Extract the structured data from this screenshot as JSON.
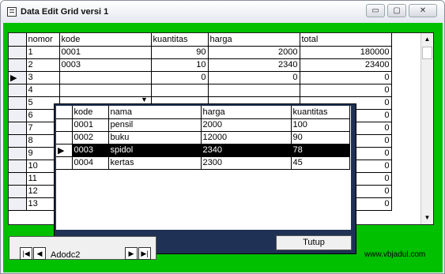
{
  "window": {
    "title": "Data Edit Grid versi 1",
    "controls": {
      "minimize": "▭",
      "maximize": "▢",
      "close": "✕"
    }
  },
  "grid": {
    "columns": [
      "nomor",
      "kode",
      "kuantitas",
      "harga",
      "total"
    ],
    "rows": [
      {
        "nomor": "1",
        "kode": "0001",
        "kuantitas": "90",
        "harga": "2000",
        "total": "180000"
      },
      {
        "nomor": "2",
        "kode": "0003",
        "kuantitas": "10",
        "harga": "2340",
        "total": "23400"
      },
      {
        "nomor": "3",
        "kode": "",
        "kuantitas": "0",
        "harga": "0",
        "total": "0"
      },
      {
        "nomor": "4",
        "total": "0"
      },
      {
        "nomor": "5",
        "total": "0"
      },
      {
        "nomor": "6",
        "total": "0"
      },
      {
        "nomor": "7",
        "total": "0"
      },
      {
        "nomor": "8",
        "total": "0"
      },
      {
        "nomor": "9",
        "total": "0"
      },
      {
        "nomor": "10",
        "total": "0"
      },
      {
        "nomor": "11",
        "total": "0"
      },
      {
        "nomor": "12",
        "total": "0"
      },
      {
        "nomor": "13",
        "total": "0"
      }
    ],
    "current_row_marker": "▶"
  },
  "dropdown": {
    "columns": [
      "kode",
      "nama",
      "harga",
      "kuantitas"
    ],
    "rows": [
      {
        "kode": "0001",
        "nama": "pensil",
        "harga": "2000",
        "kuantitas": "100"
      },
      {
        "kode": "0002",
        "nama": "buku",
        "harga": "12000",
        "kuantitas": "90"
      },
      {
        "kode": "0003",
        "nama": "spidol",
        "harga": "2340",
        "kuantitas": "78"
      },
      {
        "kode": "0004",
        "nama": "kertas",
        "harga": "2300",
        "kuantitas": "45"
      }
    ],
    "current_row_marker": "▶",
    "close_button": "Tutup"
  },
  "nav": {
    "first": "|◀",
    "prev": "◀",
    "caption": "Adodc2",
    "next": "▶",
    "last": "▶|"
  },
  "footer": {
    "website": "www.vbjadul.com"
  }
}
